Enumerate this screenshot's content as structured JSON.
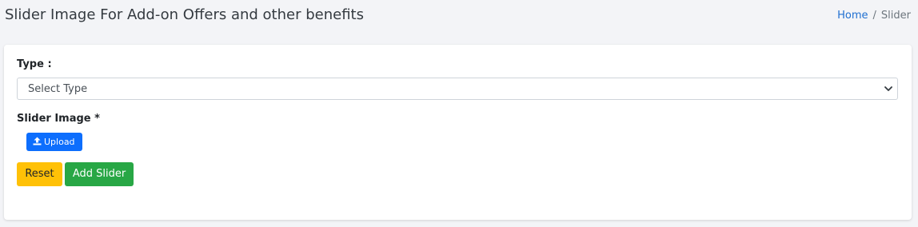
{
  "header": {
    "title": "Slider Image For Add-on Offers and other benefits"
  },
  "breadcrumb": {
    "home": "Home",
    "separator": "/",
    "current": "Slider"
  },
  "form": {
    "type_label": "Type :",
    "type_select_value": "Select Type",
    "slider_image_label": "Slider Image *",
    "upload_label": "Upload",
    "reset_label": "Reset",
    "add_label": "Add Slider"
  },
  "icons": {
    "select": "chevron-down-icon",
    "upload": "upload-icon"
  },
  "colors": {
    "upload_button": "#0d6efd",
    "reset_button": "#ffc107",
    "add_button": "#28a745",
    "breadcrumb_link": "#1f6fd1"
  }
}
